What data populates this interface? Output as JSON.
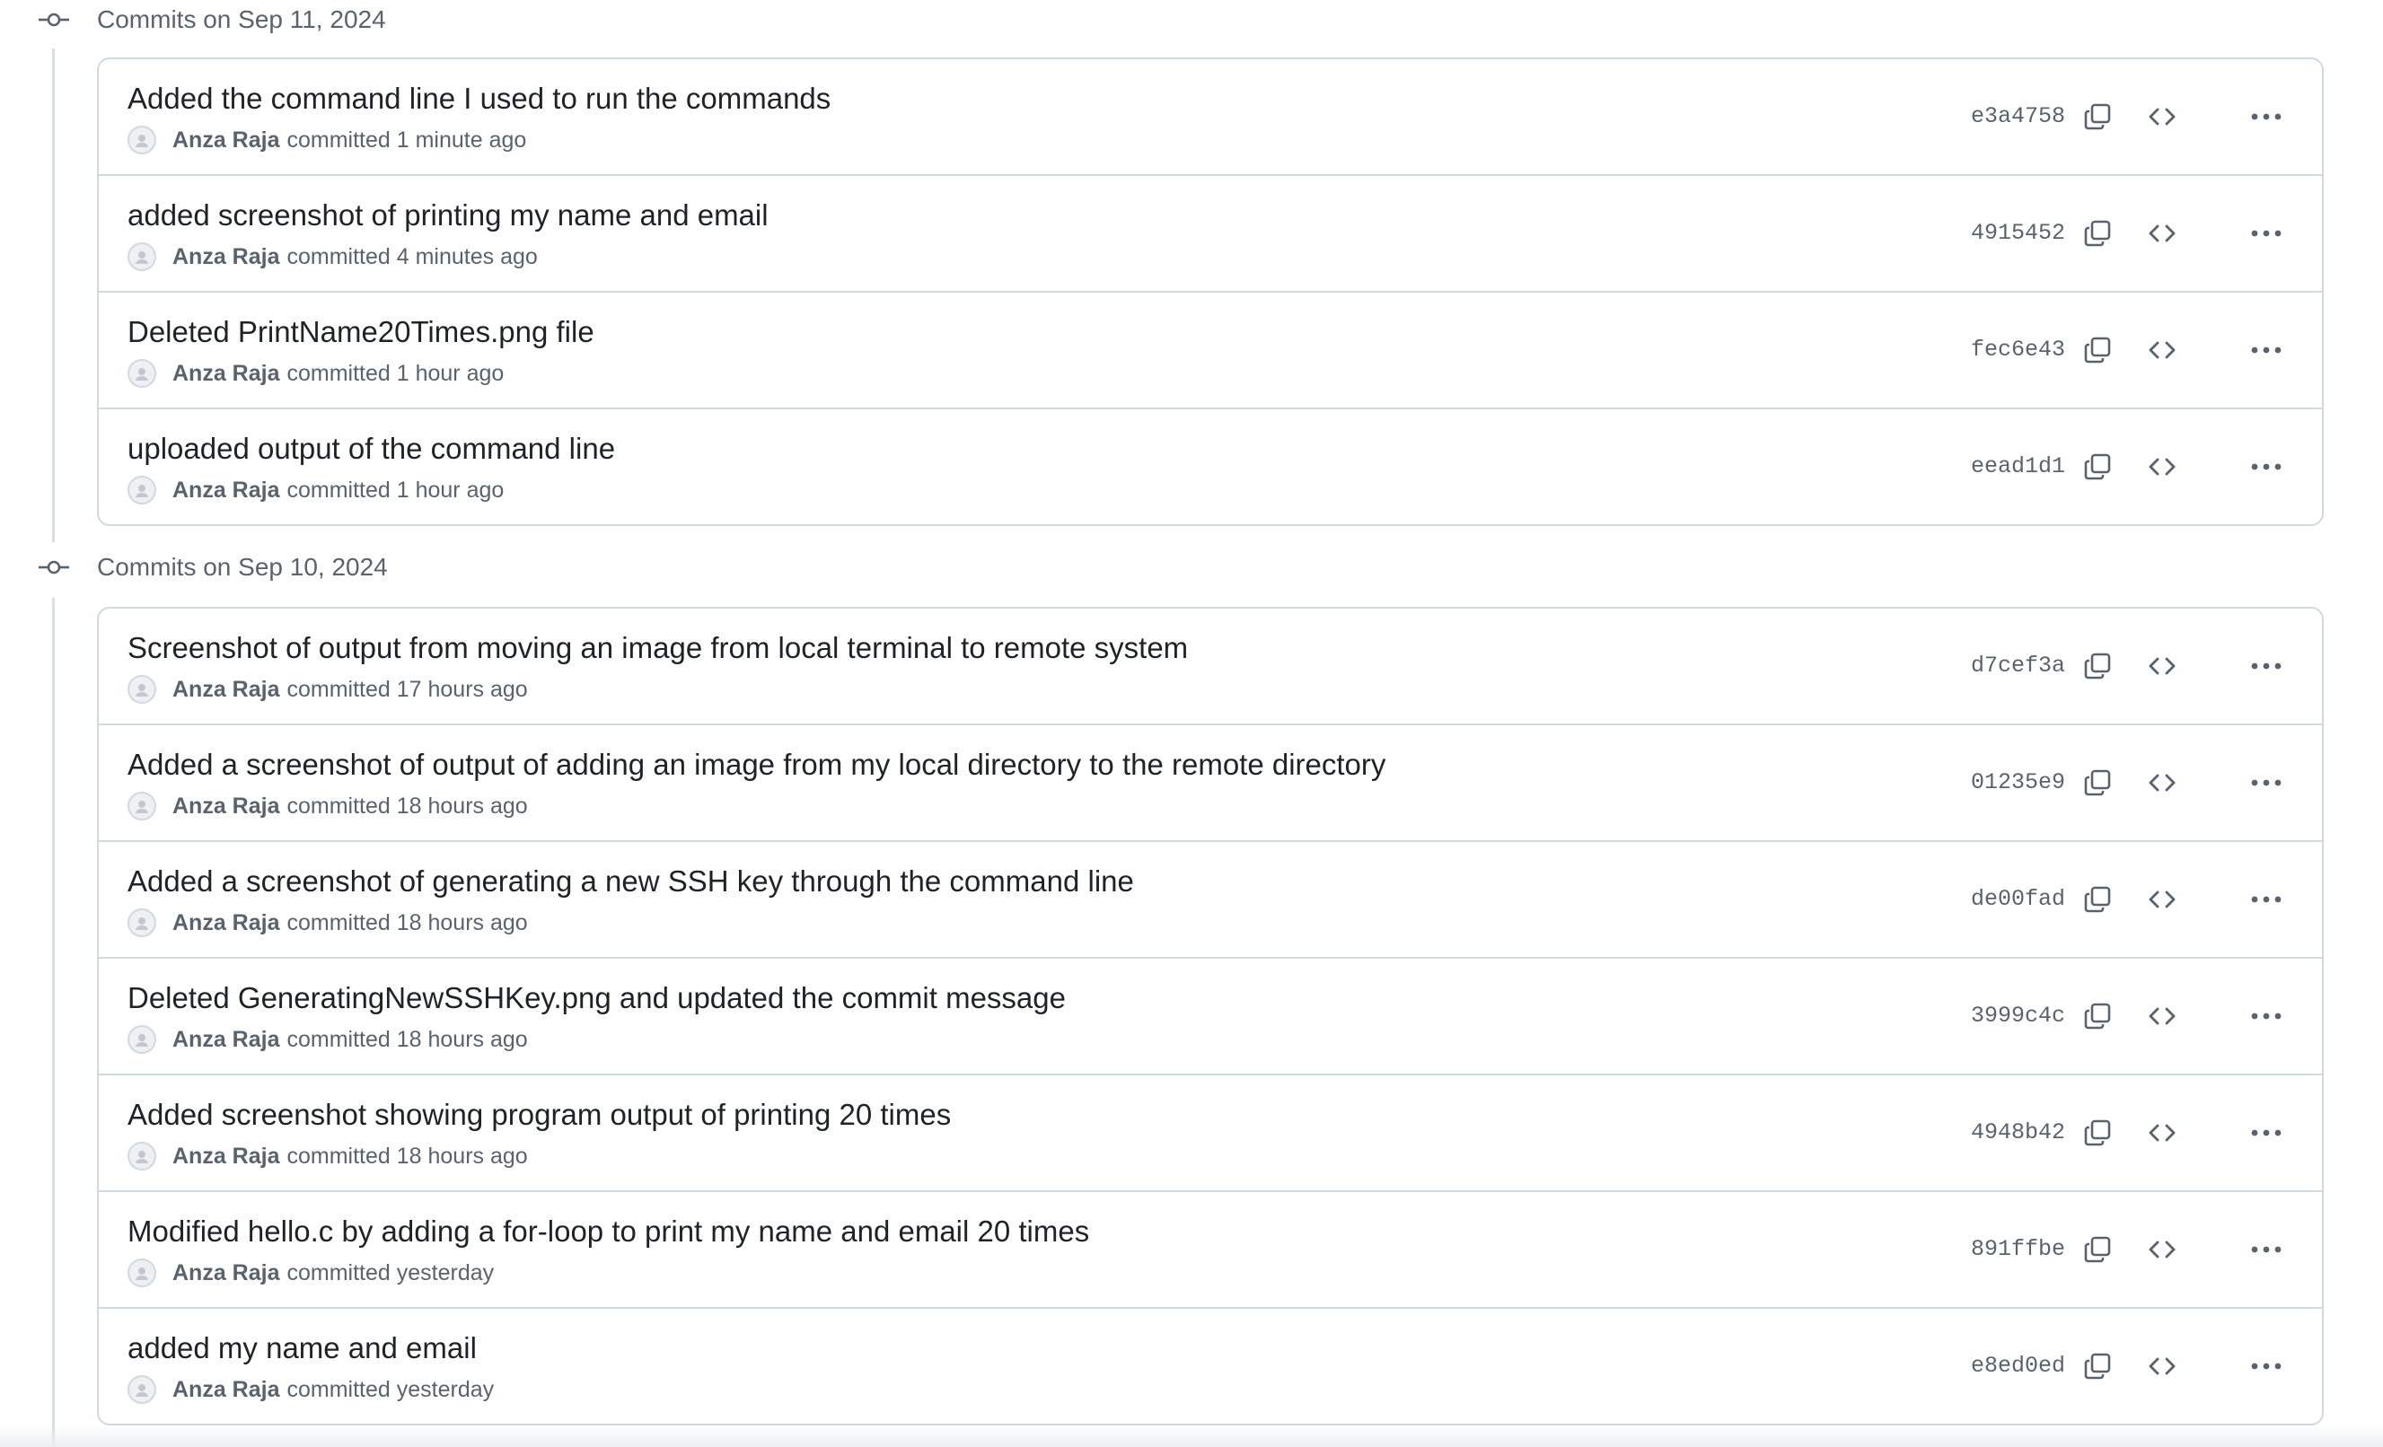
{
  "groups": [
    {
      "title": "Commits on Sep 11, 2024",
      "commits": [
        {
          "message": "Added the command line I used to run the commands",
          "author": "Anza Raja",
          "action": "committed 1 minute ago",
          "sha": "e3a4758"
        },
        {
          "message": "added screenshot of printing my name and email",
          "author": "Anza Raja",
          "action": "committed 4 minutes ago",
          "sha": "4915452"
        },
        {
          "message": "Deleted PrintName20Times.png file",
          "author": "Anza Raja",
          "action": "committed 1 hour ago",
          "sha": "fec6e43"
        },
        {
          "message": "uploaded output of the command line",
          "author": "Anza Raja",
          "action": "committed 1 hour ago",
          "sha": "eead1d1"
        }
      ]
    },
    {
      "title": "Commits on Sep 10, 2024",
      "commits": [
        {
          "message": "Screenshot of output from moving an image from local terminal to remote system",
          "author": "Anza Raja",
          "action": "committed 17 hours ago",
          "sha": "d7cef3a"
        },
        {
          "message": "Added a screenshot of output of adding an image from my local directory to the remote directory",
          "author": "Anza Raja",
          "action": "committed 18 hours ago",
          "sha": "01235e9"
        },
        {
          "message": "Added a screenshot of generating a new SSH key through the command line",
          "author": "Anza Raja",
          "action": "committed 18 hours ago",
          "sha": "de00fad"
        },
        {
          "message": "Deleted GeneratingNewSSHKey.png and updated the commit message",
          "author": "Anza Raja",
          "action": "committed 18 hours ago",
          "sha": "3999c4c"
        },
        {
          "message": "Added screenshot showing program output of printing 20 times",
          "author": "Anza Raja",
          "action": "committed 18 hours ago",
          "sha": "4948b42"
        },
        {
          "message": "Modified hello.c by adding a for-loop to print my name and email 20 times",
          "author": "Anza Raja",
          "action": "committed yesterday",
          "sha": "891ffbe"
        },
        {
          "message": "added my name and email",
          "author": "Anza Raja",
          "action": "committed yesterday",
          "sha": "e8ed0ed"
        }
      ]
    }
  ],
  "icons": {
    "group_marker": "git-commit-icon",
    "avatar": "avatar-icon",
    "copy": "copy-icon",
    "browse": "code-brackets-icon",
    "more": "kebab-horizontal-icon"
  },
  "colors": {
    "text_primary": "#1f2328",
    "text_muted": "#59636e",
    "border": "#d1d9e0",
    "timeline": "#d8dee4"
  }
}
